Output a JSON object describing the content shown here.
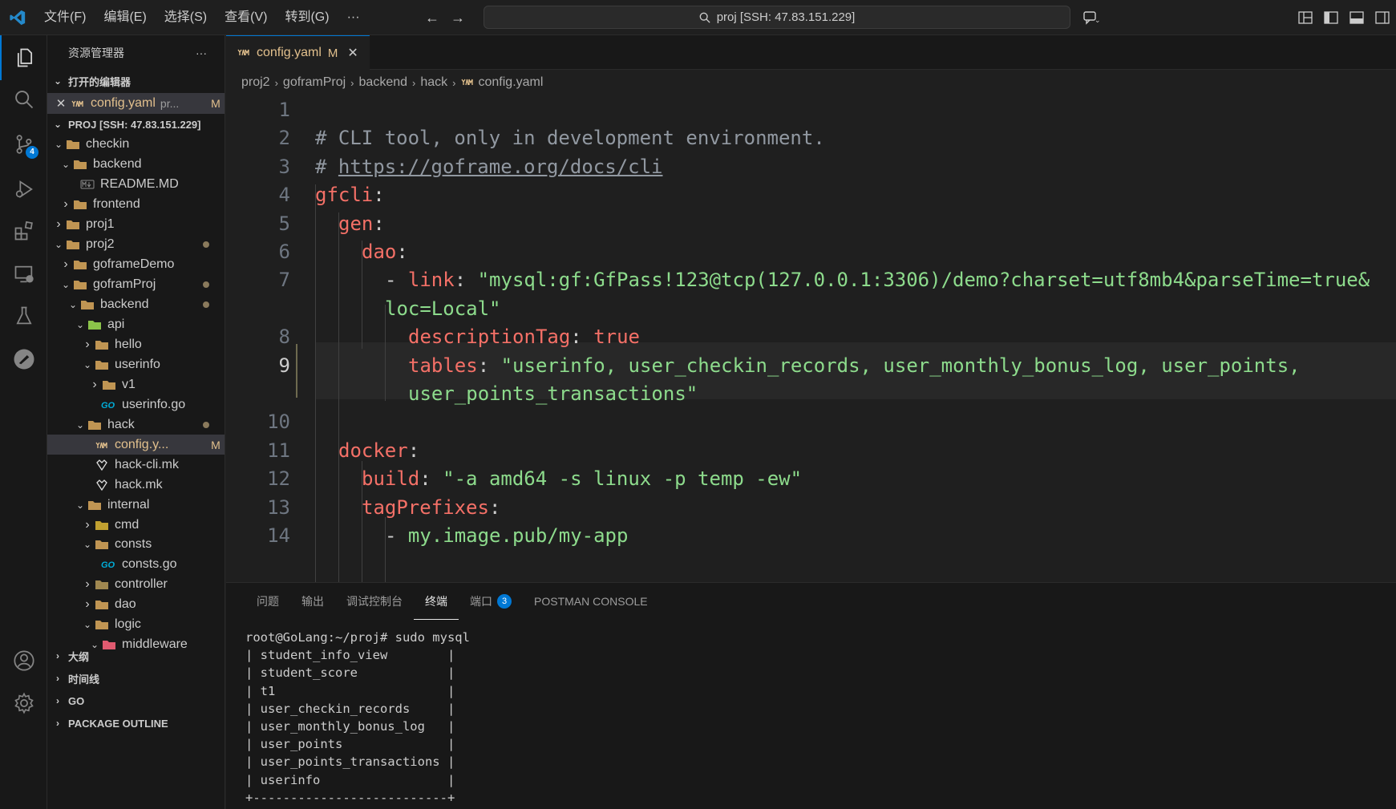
{
  "menu": [
    "文件(F)",
    "编辑(E)",
    "选择(S)",
    "查看(V)",
    "转到(G)",
    "···"
  ],
  "command_center": "proj [SSH: 47.83.151.229]",
  "activity_badge": "4",
  "sidebar": {
    "title": "资源管理器",
    "more": "···",
    "open_editors_header": "打开的编辑器",
    "open_editor": {
      "name": "config.yaml",
      "path": "pr...",
      "status": "M"
    },
    "workspace_header": "PROJ [SSH: 47.83.151.229]",
    "tree": [
      "checkin",
      "backend",
      "README.MD",
      "frontend",
      "proj1",
      "proj2",
      "goframeDemo",
      "goframProj",
      "backend",
      "api",
      "hello",
      "userinfo",
      "v1",
      "userinfo.go",
      "hack",
      "config.y...",
      "hack-cli.mk",
      "hack.mk",
      "internal",
      "cmd",
      "consts",
      "consts.go",
      "controller",
      "dao",
      "logic",
      "middleware"
    ],
    "modified_mark": "M",
    "bottom_sections": [
      "大纲",
      "时间线",
      "GO",
      "PACKAGE OUTLINE"
    ]
  },
  "tab": {
    "name": "config.yaml",
    "status": "M",
    "close": "✕"
  },
  "breadcrumb": [
    "proj2",
    "goframProj",
    "backend",
    "hack",
    "config.yaml"
  ],
  "code": {
    "line_numbers": [
      "1",
      "2",
      "3",
      "4",
      "5",
      "6",
      "7",
      "8",
      "9",
      "10",
      "11",
      "12",
      "13",
      "14"
    ],
    "c2": "# CLI tool, only in development environment.",
    "c3a": "# ",
    "c3b": "https://goframe.org/docs/cli",
    "gfcli": "gfcli",
    "gen": "gen",
    "dao": "dao",
    "dash": "- ",
    "link": "link",
    "link_val1": "\"mysql:gf:GfPass!123@tcp(127.0.0.1:3306)/demo?charset=utf8mb4&parseTime=true&",
    "link_val2": "loc=Local\"",
    "descriptionTag": "descriptionTag",
    "true": "true",
    "tables": "tables",
    "tables_val1": "\"userinfo, user_checkin_records, user_monthly_bonus_log, user_points,",
    "tables_val2": "user_points_transactions\"",
    "docker": "docker",
    "build": "build",
    "build_val": "\"-a amd64 -s linux -p temp -ew\"",
    "tagPrefixes": "tagPrefixes",
    "image": "my.image.pub/my-app",
    "colon": ":"
  },
  "panel": {
    "tabs": [
      "问题",
      "输出",
      "调试控制台",
      "终端",
      "端口",
      "POSTMAN CONSOLE"
    ],
    "ports_badge": "3",
    "terminal": [
      "root@GoLang:~/proj# sudo mysql",
      "| student_info_view        |",
      "| student_score            |",
      "| t1                       |",
      "| user_checkin_records     |",
      "| user_monthly_bonus_log   |",
      "| user_points              |",
      "| user_points_transactions |",
      "| userinfo                 |",
      "+--------------------------+"
    ]
  },
  "colors": {
    "accent": "#0078d4",
    "modified": "#e2c08d",
    "keyword": "#f47067",
    "string": "#8ddb8c"
  }
}
